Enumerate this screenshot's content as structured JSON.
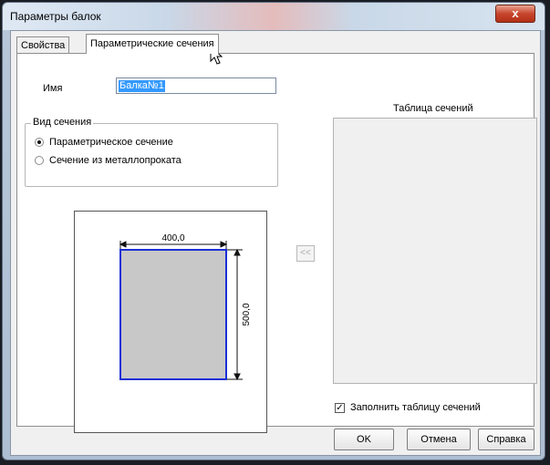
{
  "window": {
    "title": "Параметры балок",
    "close_label": "x"
  },
  "tabs": [
    {
      "label": "Свойства"
    },
    {
      "label": "Параметрические сечения"
    }
  ],
  "properties": {
    "name_label": "Имя",
    "name_value": "Балка№1",
    "section_group": {
      "legend": "Вид сечения",
      "options": [
        {
          "label": "Параметрическое сечение",
          "selected": true
        },
        {
          "label": "Сечение из металлопроката",
          "selected": false
        }
      ]
    },
    "preview": {
      "width_value": "400,0",
      "height_value": "500,0"
    },
    "transfer_button": "<<",
    "sections_table": {
      "title": "Таблица сечений"
    },
    "fill_table": {
      "label": "Заполнить таблицу сечений",
      "checked": true
    }
  },
  "buttons": {
    "ok": "OK",
    "cancel": "Отмена",
    "help": "Справка"
  },
  "colors": {
    "selection": "#3399ff",
    "section_fill": "#c8c8c8",
    "section_border": "#1a2fd6",
    "close_button": "#c7452c"
  }
}
